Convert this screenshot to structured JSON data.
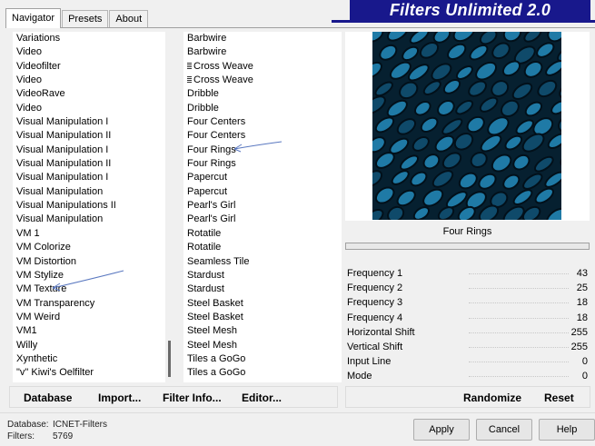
{
  "banner": {
    "title": "Filters Unlimited 2.0"
  },
  "tabs": [
    {
      "label": "Navigator",
      "active": true
    },
    {
      "label": "Presets",
      "active": false
    },
    {
      "label": "About",
      "active": false
    }
  ],
  "categories": [
    "Variations",
    "Video",
    "Videofilter",
    "Video",
    "VideoRave",
    "Video",
    "Visual Manipulation I",
    "Visual Manipulation II",
    "Visual Manipulation I",
    "Visual Manipulation II",
    "Visual Manipulation I",
    "Visual Manipulation",
    "Visual Manipulations II",
    "Visual Manipulation",
    "VM 1",
    "VM Colorize",
    "VM Distortion",
    "VM Stylize",
    "VM Texture",
    "VM Transparency",
    "VM Weird",
    "VM1",
    "Willy",
    "Xynthetic",
    "\"v\" Kiwi's Oelfilter"
  ],
  "filters": [
    {
      "label": "Barbwire",
      "grip": false
    },
    {
      "label": "Barbwire",
      "grip": false
    },
    {
      "label": "Cross Weave",
      "grip": true
    },
    {
      "label": "Cross Weave",
      "grip": true
    },
    {
      "label": "Dribble",
      "grip": false
    },
    {
      "label": "Dribble",
      "grip": false
    },
    {
      "label": "Four Centers",
      "grip": false
    },
    {
      "label": "Four Centers",
      "grip": false
    },
    {
      "label": "Four Rings",
      "grip": false
    },
    {
      "label": "Four Rings",
      "grip": false
    },
    {
      "label": "Papercut",
      "grip": false
    },
    {
      "label": "Papercut",
      "grip": false
    },
    {
      "label": "Pearl's Girl",
      "grip": false
    },
    {
      "label": "Pearl's Girl",
      "grip": false
    },
    {
      "label": "Rotatile",
      "grip": false
    },
    {
      "label": "Rotatile",
      "grip": false
    },
    {
      "label": "Seamless Tile",
      "grip": false
    },
    {
      "label": "Stardust",
      "grip": false
    },
    {
      "label": "Stardust",
      "grip": false
    },
    {
      "label": "Steel Basket",
      "grip": false
    },
    {
      "label": "Steel Basket",
      "grip": false
    },
    {
      "label": "Steel Mesh",
      "grip": false
    },
    {
      "label": "Steel Mesh",
      "grip": false
    },
    {
      "label": "Tiles a GoGo",
      "grip": false
    },
    {
      "label": "Tiles a GoGo",
      "grip": false
    }
  ],
  "preview": {
    "filter_name": "Four Rings",
    "colors": {
      "dark": "#062030",
      "mid": "#0f4a6a",
      "light": "#1f7aa6"
    }
  },
  "params": [
    {
      "label": "Frequency 1",
      "value": "43"
    },
    {
      "label": "Frequency 2",
      "value": "25"
    },
    {
      "label": "Frequency 3",
      "value": "18"
    },
    {
      "label": "Frequency 4",
      "value": "18"
    },
    {
      "label": "Horizontal Shift",
      "value": "255"
    },
    {
      "label": "Vertical Shift",
      "value": "255"
    },
    {
      "label": "Input Line",
      "value": "0"
    },
    {
      "label": "Mode",
      "value": "0"
    }
  ],
  "panel_buttons": {
    "database": "Database",
    "import": "Import...",
    "filter_info": "Filter Info...",
    "editor": "Editor...",
    "randomize": "Randomize",
    "reset": "Reset"
  },
  "footer": {
    "database_label": "Database:",
    "database_value": "ICNET-Filters",
    "filters_label": "Filters:",
    "filters_value": "5769",
    "apply": "Apply",
    "cancel": "Cancel",
    "help": "Help"
  },
  "colors": {
    "banner": "#18188c",
    "arrow": "#5a78c0"
  }
}
